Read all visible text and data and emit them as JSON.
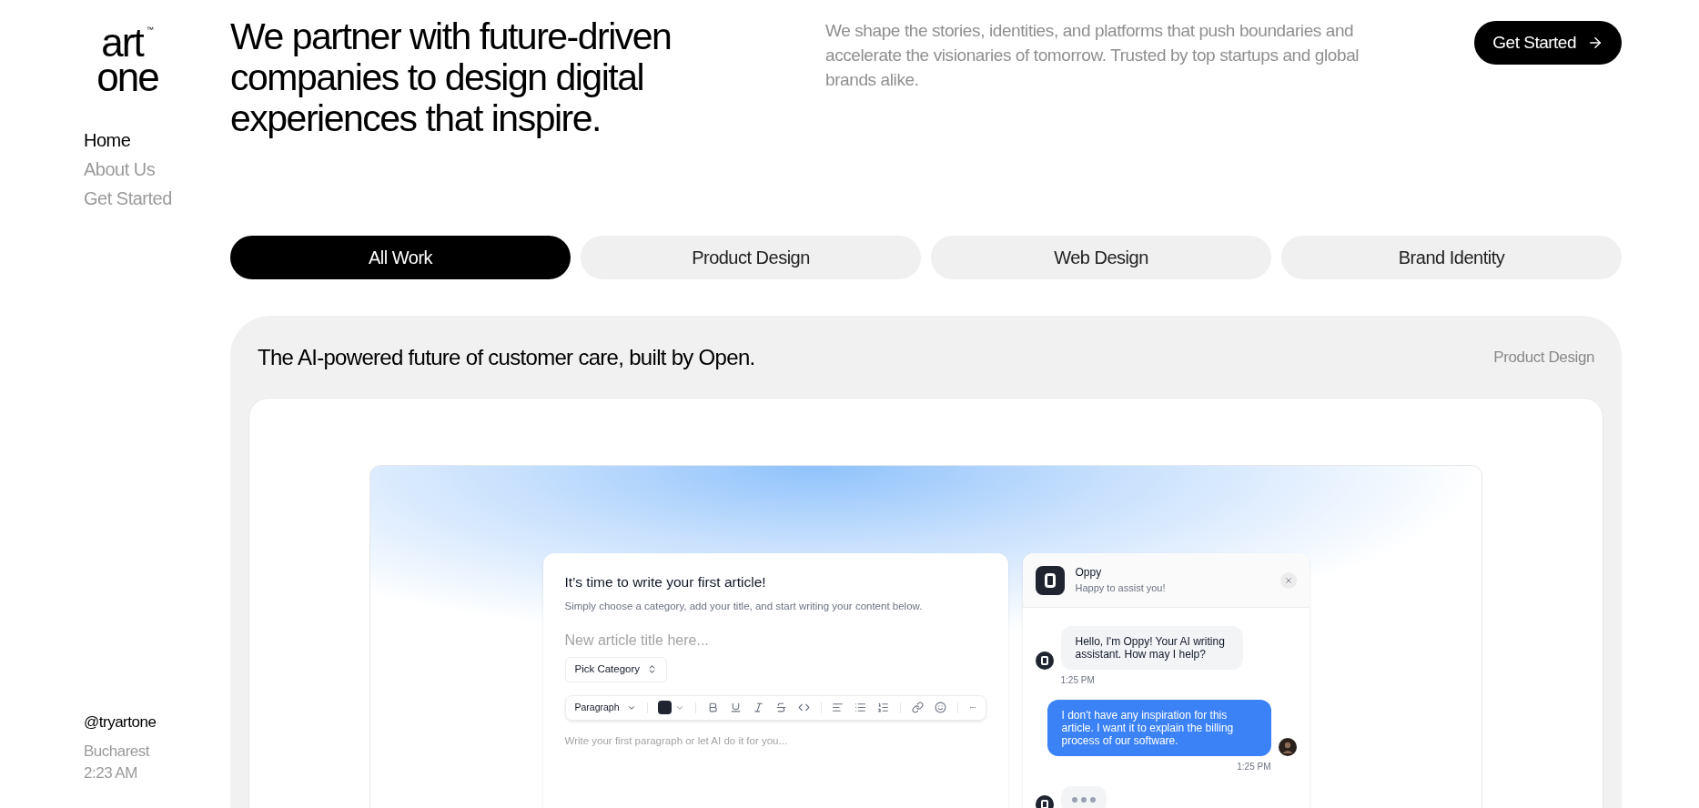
{
  "brand": {
    "logo_top": "art",
    "logo_bottom": "one",
    "trademark": "™"
  },
  "nav": [
    {
      "label": "Home",
      "selected": true
    },
    {
      "label": "About Us",
      "selected": false
    },
    {
      "label": "Get Started",
      "selected": false
    }
  ],
  "footer": {
    "handle": "@tryartone",
    "city": "Bucharest",
    "time": "2:23 AM"
  },
  "headline": "We partner with future-driven companies to design digital experiences that inspire.",
  "intro": "We shape the stories, identities, and platforms that push boundaries and accelerate the visionaries of tomorrow. Trusted by top startups and global brands alike.",
  "cta": {
    "label": "Get Started"
  },
  "filters": [
    {
      "label": "All Work",
      "selected": true
    },
    {
      "label": "Product Design",
      "selected": false
    },
    {
      "label": "Web Design",
      "selected": false
    },
    {
      "label": "Brand Identity",
      "selected": false
    }
  ],
  "project": {
    "title": "The AI-powered future of customer care, built by Open.",
    "category": "Product Design",
    "editor": {
      "title": "It’s time to write your first article!",
      "subtitle": "Simply choose a category, add your title, and start writing your content below.",
      "title_placeholder": "New article title here...",
      "category_select": "Pick Category",
      "block_style": "Paragraph",
      "body_placeholder": "Write your first paragraph or let AI do it for you..."
    },
    "chat": {
      "name": "Oppy",
      "status": "Happy to assist you!",
      "messages": [
        {
          "kind": "bot",
          "text": "Hello, I'm Oppy! Your AI writing assistant. How may I help?",
          "time": "1:25 PM"
        },
        {
          "kind": "user",
          "text": "I don't have any inspiration for this article. I want it to explain the billing process of our software.",
          "time": "1:25 PM"
        },
        {
          "kind": "typing"
        }
      ]
    }
  }
}
